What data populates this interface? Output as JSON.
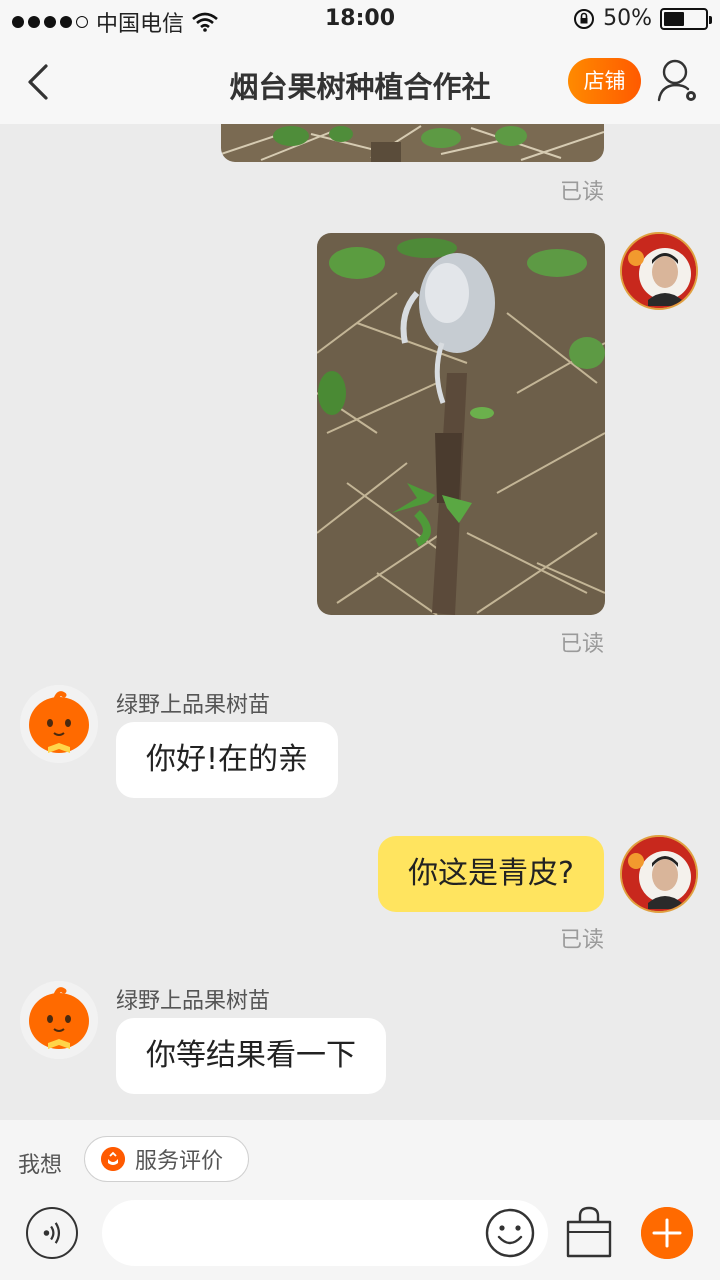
{
  "status_bar": {
    "carrier": "中国电信",
    "time": "18:00",
    "battery_percent": "50%",
    "battery_level": 0.5
  },
  "nav": {
    "title": "烟台果树种植合作社",
    "shop_label": "店铺"
  },
  "messages": [
    {
      "id": "m1",
      "sender": "me",
      "type": "image",
      "status": "已读"
    },
    {
      "id": "m2",
      "sender": "me",
      "type": "image",
      "status": "已读"
    },
    {
      "id": "m3",
      "sender": "shop",
      "name": "绿野上品果树苗",
      "type": "text",
      "text": "你好!在的亲"
    },
    {
      "id": "m4",
      "sender": "me",
      "type": "text",
      "text": "你这是青皮?",
      "status": "已读"
    },
    {
      "id": "m5",
      "sender": "shop",
      "name": "绿野上品果树苗",
      "type": "text",
      "text": "你等结果看一下"
    }
  ],
  "quick_bar": {
    "label": "我想",
    "service_review": "服务评价"
  },
  "input": {
    "placeholder": ""
  },
  "colors": {
    "accent": "#ff6a00",
    "my_bubble": "#ffe45f",
    "chat_bg": "#ebebeb"
  },
  "icons": [
    "back-icon",
    "user-settings-icon",
    "voice-icon",
    "emoji-icon",
    "shopping-bag-icon",
    "plus-icon"
  ]
}
